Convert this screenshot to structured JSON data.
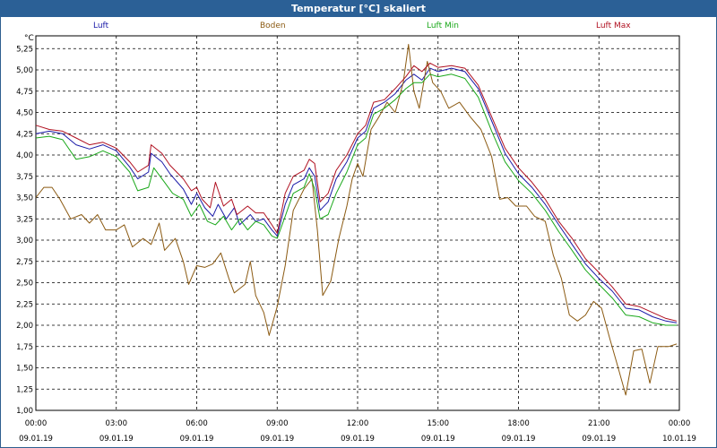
{
  "header": {
    "title": "Temperatur [°C] skaliert"
  },
  "legend": [
    {
      "label": "Luft",
      "color": "#1a1aa8"
    },
    {
      "label": "Boden",
      "color": "#8b5a12"
    },
    {
      "label": "Luft Min",
      "color": "#1aa81a"
    },
    {
      "label": "Luft Max",
      "color": "#b01020"
    }
  ],
  "y_unit": "°C",
  "chart_data": {
    "type": "line",
    "title": "Temperatur [°C] skaliert",
    "xlabel": "",
    "ylabel": "°C",
    "ylim": [
      1.0,
      5.4
    ],
    "xlim": [
      0,
      24
    ],
    "grid": true,
    "legend_position": "top",
    "y_ticks": [
      "1,00",
      "1,25",
      "1,50",
      "1,75",
      "2,00",
      "2,25",
      "2,50",
      "2,75",
      "3,00",
      "3,25",
      "3,50",
      "3,75",
      "4,00",
      "4,25",
      "4,50",
      "4,75",
      "5,00",
      "5,25"
    ],
    "x_ticks": [
      {
        "time": "00:00",
        "date": "09.01.19"
      },
      {
        "time": "03:00",
        "date": "09.01.19"
      },
      {
        "time": "06:00",
        "date": "09.01.19"
      },
      {
        "time": "09:00",
        "date": "09.01.19"
      },
      {
        "time": "12:00",
        "date": "09.01.19"
      },
      {
        "time": "15:00",
        "date": "09.01.19"
      },
      {
        "time": "18:00",
        "date": "09.01.19"
      },
      {
        "time": "21:00",
        "date": "09.01.19"
      },
      {
        "time": "00:00",
        "date": "10.01.19"
      }
    ],
    "series": [
      {
        "name": "Luft",
        "color": "#1a1aa8",
        "points": [
          [
            0,
            4.25
          ],
          [
            0.5,
            4.28
          ],
          [
            1,
            4.25
          ],
          [
            1.5,
            4.12
          ],
          [
            2,
            4.07
          ],
          [
            2.5,
            4.12
          ],
          [
            3,
            4.05
          ],
          [
            3.5,
            3.86
          ],
          [
            3.8,
            3.72
          ],
          [
            4.2,
            3.8
          ],
          [
            4.3,
            4.02
          ],
          [
            4.7,
            3.92
          ],
          [
            5,
            3.78
          ],
          [
            5.5,
            3.6
          ],
          [
            5.8,
            3.42
          ],
          [
            6,
            3.55
          ],
          [
            6.3,
            3.38
          ],
          [
            6.6,
            3.28
          ],
          [
            6.8,
            3.42
          ],
          [
            7.1,
            3.25
          ],
          [
            7.4,
            3.38
          ],
          [
            7.6,
            3.18
          ],
          [
            8,
            3.3
          ],
          [
            8.2,
            3.22
          ],
          [
            8.5,
            3.25
          ],
          [
            8.8,
            3.12
          ],
          [
            9,
            3.05
          ],
          [
            9.3,
            3.42
          ],
          [
            9.6,
            3.65
          ],
          [
            10,
            3.72
          ],
          [
            10.2,
            3.85
          ],
          [
            10.4,
            3.75
          ],
          [
            10.6,
            3.35
          ],
          [
            10.9,
            3.45
          ],
          [
            11.2,
            3.72
          ],
          [
            11.6,
            3.92
          ],
          [
            12,
            4.2
          ],
          [
            12.3,
            4.28
          ],
          [
            12.6,
            4.55
          ],
          [
            13,
            4.62
          ],
          [
            13.4,
            4.72
          ],
          [
            13.8,
            4.88
          ],
          [
            14.1,
            4.95
          ],
          [
            14.4,
            4.88
          ],
          [
            14.7,
            5.02
          ],
          [
            15,
            4.98
          ],
          [
            15.5,
            5.02
          ],
          [
            16,
            4.98
          ],
          [
            16.5,
            4.78
          ],
          [
            17,
            4.4
          ],
          [
            17.5,
            4.02
          ],
          [
            18,
            3.78
          ],
          [
            18.5,
            3.62
          ],
          [
            19,
            3.42
          ],
          [
            19.5,
            3.18
          ],
          [
            20,
            2.95
          ],
          [
            20.5,
            2.72
          ],
          [
            21,
            2.55
          ],
          [
            21.5,
            2.4
          ],
          [
            22,
            2.2
          ],
          [
            22.5,
            2.18
          ],
          [
            23,
            2.1
          ],
          [
            23.5,
            2.05
          ],
          [
            23.9,
            2.03
          ]
        ]
      },
      {
        "name": "Boden",
        "color": "#8b5a12",
        "points": [
          [
            0,
            3.5
          ],
          [
            0.3,
            3.62
          ],
          [
            0.6,
            3.62
          ],
          [
            0.9,
            3.48
          ],
          [
            1.3,
            3.25
          ],
          [
            1.7,
            3.3
          ],
          [
            2,
            3.2
          ],
          [
            2.3,
            3.3
          ],
          [
            2.6,
            3.12
          ],
          [
            3,
            3.12
          ],
          [
            3.3,
            3.18
          ],
          [
            3.6,
            2.92
          ],
          [
            4,
            3.02
          ],
          [
            4.3,
            2.95
          ],
          [
            4.6,
            3.2
          ],
          [
            4.8,
            2.88
          ],
          [
            5.2,
            3.02
          ],
          [
            5.5,
            2.75
          ],
          [
            5.7,
            2.48
          ],
          [
            6,
            2.7
          ],
          [
            6.3,
            2.68
          ],
          [
            6.6,
            2.72
          ],
          [
            6.9,
            2.85
          ],
          [
            7.2,
            2.55
          ],
          [
            7.4,
            2.38
          ],
          [
            7.8,
            2.48
          ],
          [
            8,
            2.75
          ],
          [
            8.2,
            2.35
          ],
          [
            8.5,
            2.15
          ],
          [
            8.7,
            1.88
          ],
          [
            9,
            2.22
          ],
          [
            9.3,
            2.7
          ],
          [
            9.6,
            3.35
          ],
          [
            10,
            3.6
          ],
          [
            10.3,
            3.72
          ],
          [
            10.5,
            3.12
          ],
          [
            10.7,
            2.35
          ],
          [
            11,
            2.52
          ],
          [
            11.3,
            3.02
          ],
          [
            11.6,
            3.4
          ],
          [
            11.8,
            3.72
          ],
          [
            12,
            3.9
          ],
          [
            12.2,
            3.75
          ],
          [
            12.5,
            4.3
          ],
          [
            12.8,
            4.45
          ],
          [
            13.1,
            4.62
          ],
          [
            13.4,
            4.5
          ],
          [
            13.7,
            4.85
          ],
          [
            13.9,
            5.3
          ],
          [
            14.1,
            4.75
          ],
          [
            14.3,
            4.55
          ],
          [
            14.6,
            5.1
          ],
          [
            14.8,
            4.85
          ],
          [
            15.1,
            4.75
          ],
          [
            15.4,
            4.55
          ],
          [
            15.8,
            4.62
          ],
          [
            16.2,
            4.45
          ],
          [
            16.6,
            4.3
          ],
          [
            17,
            3.98
          ],
          [
            17.3,
            3.48
          ],
          [
            17.6,
            3.5
          ],
          [
            17.9,
            3.4
          ],
          [
            18.3,
            3.4
          ],
          [
            18.6,
            3.28
          ],
          [
            19,
            3.22
          ],
          [
            19.3,
            2.82
          ],
          [
            19.6,
            2.55
          ],
          [
            19.9,
            2.12
          ],
          [
            20.2,
            2.05
          ],
          [
            20.5,
            2.12
          ],
          [
            20.8,
            2.28
          ],
          [
            21.1,
            2.2
          ],
          [
            21.4,
            1.85
          ],
          [
            21.7,
            1.52
          ],
          [
            22,
            1.18
          ],
          [
            22.3,
            1.7
          ],
          [
            22.6,
            1.72
          ],
          [
            22.9,
            1.32
          ],
          [
            23.2,
            1.75
          ],
          [
            23.6,
            1.75
          ],
          [
            23.9,
            1.78
          ]
        ]
      },
      {
        "name": "Luft Min",
        "color": "#1aa81a",
        "points": [
          [
            0,
            4.2
          ],
          [
            0.5,
            4.22
          ],
          [
            1,
            4.18
          ],
          [
            1.5,
            3.95
          ],
          [
            2,
            3.98
          ],
          [
            2.5,
            4.05
          ],
          [
            3,
            3.98
          ],
          [
            3.5,
            3.8
          ],
          [
            3.8,
            3.58
          ],
          [
            4.2,
            3.62
          ],
          [
            4.4,
            3.85
          ],
          [
            4.8,
            3.68
          ],
          [
            5.1,
            3.55
          ],
          [
            5.5,
            3.48
          ],
          [
            5.8,
            3.28
          ],
          [
            6.1,
            3.42
          ],
          [
            6.4,
            3.22
          ],
          [
            6.7,
            3.18
          ],
          [
            7,
            3.28
          ],
          [
            7.3,
            3.12
          ],
          [
            7.6,
            3.25
          ],
          [
            7.9,
            3.12
          ],
          [
            8.2,
            3.22
          ],
          [
            8.5,
            3.18
          ],
          [
            8.8,
            3.05
          ],
          [
            9,
            3.02
          ],
          [
            9.3,
            3.28
          ],
          [
            9.6,
            3.55
          ],
          [
            10,
            3.62
          ],
          [
            10.2,
            3.78
          ],
          [
            10.4,
            3.6
          ],
          [
            10.6,
            3.25
          ],
          [
            10.9,
            3.3
          ],
          [
            11.2,
            3.55
          ],
          [
            11.6,
            3.8
          ],
          [
            12,
            4.12
          ],
          [
            12.3,
            4.2
          ],
          [
            12.6,
            4.48
          ],
          [
            13,
            4.55
          ],
          [
            13.4,
            4.65
          ],
          [
            13.8,
            4.78
          ],
          [
            14.1,
            4.85
          ],
          [
            14.4,
            4.85
          ],
          [
            14.7,
            4.95
          ],
          [
            15,
            4.92
          ],
          [
            15.5,
            4.95
          ],
          [
            16,
            4.9
          ],
          [
            16.5,
            4.68
          ],
          [
            17,
            4.28
          ],
          [
            17.5,
            3.92
          ],
          [
            18,
            3.7
          ],
          [
            18.5,
            3.55
          ],
          [
            19,
            3.35
          ],
          [
            19.5,
            3.1
          ],
          [
            20,
            2.88
          ],
          [
            20.5,
            2.65
          ],
          [
            21,
            2.48
          ],
          [
            21.5,
            2.32
          ],
          [
            22,
            2.12
          ],
          [
            22.5,
            2.1
          ],
          [
            23,
            2.03
          ],
          [
            23.5,
            2.0
          ],
          [
            23.9,
            2.0
          ]
        ]
      },
      {
        "name": "Luft Max",
        "color": "#b01020",
        "points": [
          [
            0,
            4.35
          ],
          [
            0.5,
            4.3
          ],
          [
            1,
            4.28
          ],
          [
            1.5,
            4.2
          ],
          [
            2,
            4.12
          ],
          [
            2.5,
            4.15
          ],
          [
            3,
            4.08
          ],
          [
            3.5,
            3.92
          ],
          [
            3.8,
            3.8
          ],
          [
            4.2,
            3.88
          ],
          [
            4.3,
            4.12
          ],
          [
            4.7,
            4.02
          ],
          [
            5,
            3.88
          ],
          [
            5.5,
            3.72
          ],
          [
            5.8,
            3.58
          ],
          [
            6,
            3.62
          ],
          [
            6.2,
            3.48
          ],
          [
            6.5,
            3.38
          ],
          [
            6.7,
            3.68
          ],
          [
            7,
            3.4
          ],
          [
            7.3,
            3.48
          ],
          [
            7.5,
            3.3
          ],
          [
            7.9,
            3.4
          ],
          [
            8.2,
            3.32
          ],
          [
            8.5,
            3.32
          ],
          [
            8.8,
            3.18
          ],
          [
            9,
            3.08
          ],
          [
            9.3,
            3.55
          ],
          [
            9.6,
            3.75
          ],
          [
            10,
            3.82
          ],
          [
            10.2,
            3.95
          ],
          [
            10.4,
            3.9
          ],
          [
            10.6,
            3.45
          ],
          [
            10.9,
            3.55
          ],
          [
            11.2,
            3.82
          ],
          [
            11.6,
            4.0
          ],
          [
            12,
            4.25
          ],
          [
            12.3,
            4.35
          ],
          [
            12.6,
            4.62
          ],
          [
            13,
            4.65
          ],
          [
            13.4,
            4.78
          ],
          [
            13.8,
            4.92
          ],
          [
            14.1,
            5.05
          ],
          [
            14.4,
            4.98
          ],
          [
            14.7,
            5.08
          ],
          [
            15,
            5.03
          ],
          [
            15.5,
            5.05
          ],
          [
            16,
            5.02
          ],
          [
            16.5,
            4.82
          ],
          [
            17,
            4.45
          ],
          [
            17.5,
            4.08
          ],
          [
            18,
            3.85
          ],
          [
            18.5,
            3.68
          ],
          [
            19,
            3.48
          ],
          [
            19.5,
            3.22
          ],
          [
            20,
            3.02
          ],
          [
            20.5,
            2.78
          ],
          [
            21,
            2.62
          ],
          [
            21.5,
            2.45
          ],
          [
            22,
            2.25
          ],
          [
            22.5,
            2.22
          ],
          [
            23,
            2.15
          ],
          [
            23.5,
            2.08
          ],
          [
            23.9,
            2.05
          ]
        ]
      }
    ]
  }
}
